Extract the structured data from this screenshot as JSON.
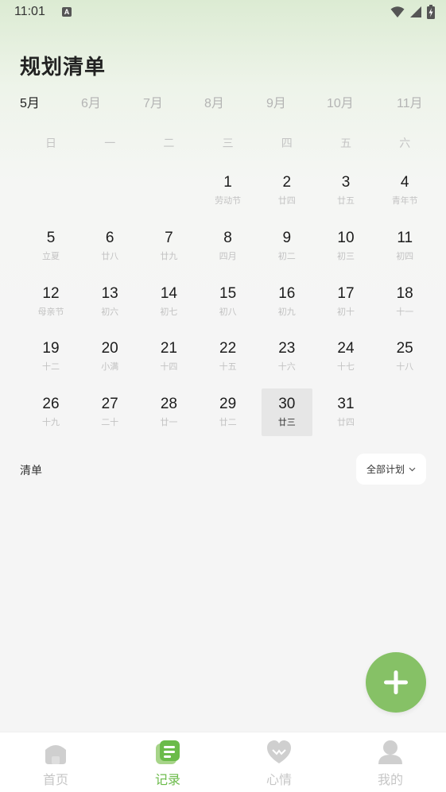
{
  "status_bar": {
    "time": "11:01",
    "notification_icon": "a-badge-icon",
    "icons": [
      "wifi-icon",
      "signal-icon",
      "battery-charging-icon"
    ]
  },
  "page": {
    "title": "规划清单"
  },
  "months": [
    {
      "label": "5月",
      "active": true
    },
    {
      "label": "6月",
      "active": false
    },
    {
      "label": "7月",
      "active": false
    },
    {
      "label": "8月",
      "active": false
    },
    {
      "label": "9月",
      "active": false
    },
    {
      "label": "10月",
      "active": false
    },
    {
      "label": "11月",
      "active": false
    }
  ],
  "weekdays": [
    "日",
    "一",
    "二",
    "三",
    "四",
    "五",
    "六"
  ],
  "calendar": {
    "selected_day": "30",
    "days": [
      {
        "day": "1",
        "sub": "劳动节"
      },
      {
        "day": "2",
        "sub": "廿四"
      },
      {
        "day": "3",
        "sub": "廿五"
      },
      {
        "day": "4",
        "sub": "青年节"
      },
      {
        "day": "5",
        "sub": "立夏"
      },
      {
        "day": "6",
        "sub": "廿八"
      },
      {
        "day": "7",
        "sub": "廿九"
      },
      {
        "day": "8",
        "sub": "四月"
      },
      {
        "day": "9",
        "sub": "初二"
      },
      {
        "day": "10",
        "sub": "初三"
      },
      {
        "day": "11",
        "sub": "初四"
      },
      {
        "day": "12",
        "sub": "母亲节"
      },
      {
        "day": "13",
        "sub": "初六"
      },
      {
        "day": "14",
        "sub": "初七"
      },
      {
        "day": "15",
        "sub": "初八"
      },
      {
        "day": "16",
        "sub": "初九"
      },
      {
        "day": "17",
        "sub": "初十"
      },
      {
        "day": "18",
        "sub": "十一"
      },
      {
        "day": "19",
        "sub": "十二"
      },
      {
        "day": "20",
        "sub": "小满"
      },
      {
        "day": "21",
        "sub": "十四"
      },
      {
        "day": "22",
        "sub": "十五"
      },
      {
        "day": "23",
        "sub": "十六"
      },
      {
        "day": "24",
        "sub": "十七"
      },
      {
        "day": "25",
        "sub": "十八"
      },
      {
        "day": "26",
        "sub": "十九"
      },
      {
        "day": "27",
        "sub": "二十"
      },
      {
        "day": "28",
        "sub": "廿一"
      },
      {
        "day": "29",
        "sub": "廿二"
      },
      {
        "day": "30",
        "sub": "廿三"
      },
      {
        "day": "31",
        "sub": "廿四"
      }
    ]
  },
  "list": {
    "title": "清单",
    "filter_label": "全部计划"
  },
  "fab": {
    "icon": "plus-icon"
  },
  "colors": {
    "accent": "#86c166",
    "nav_active": "#6bbb4a",
    "selected_day_bg": "#e6e6e6"
  },
  "nav": [
    {
      "label": "首页",
      "icon": "home-icon",
      "active": false
    },
    {
      "label": "记录",
      "icon": "notes-icon",
      "active": true
    },
    {
      "label": "心情",
      "icon": "heart-icon",
      "active": false
    },
    {
      "label": "我的",
      "icon": "profile-icon",
      "active": false
    }
  ]
}
